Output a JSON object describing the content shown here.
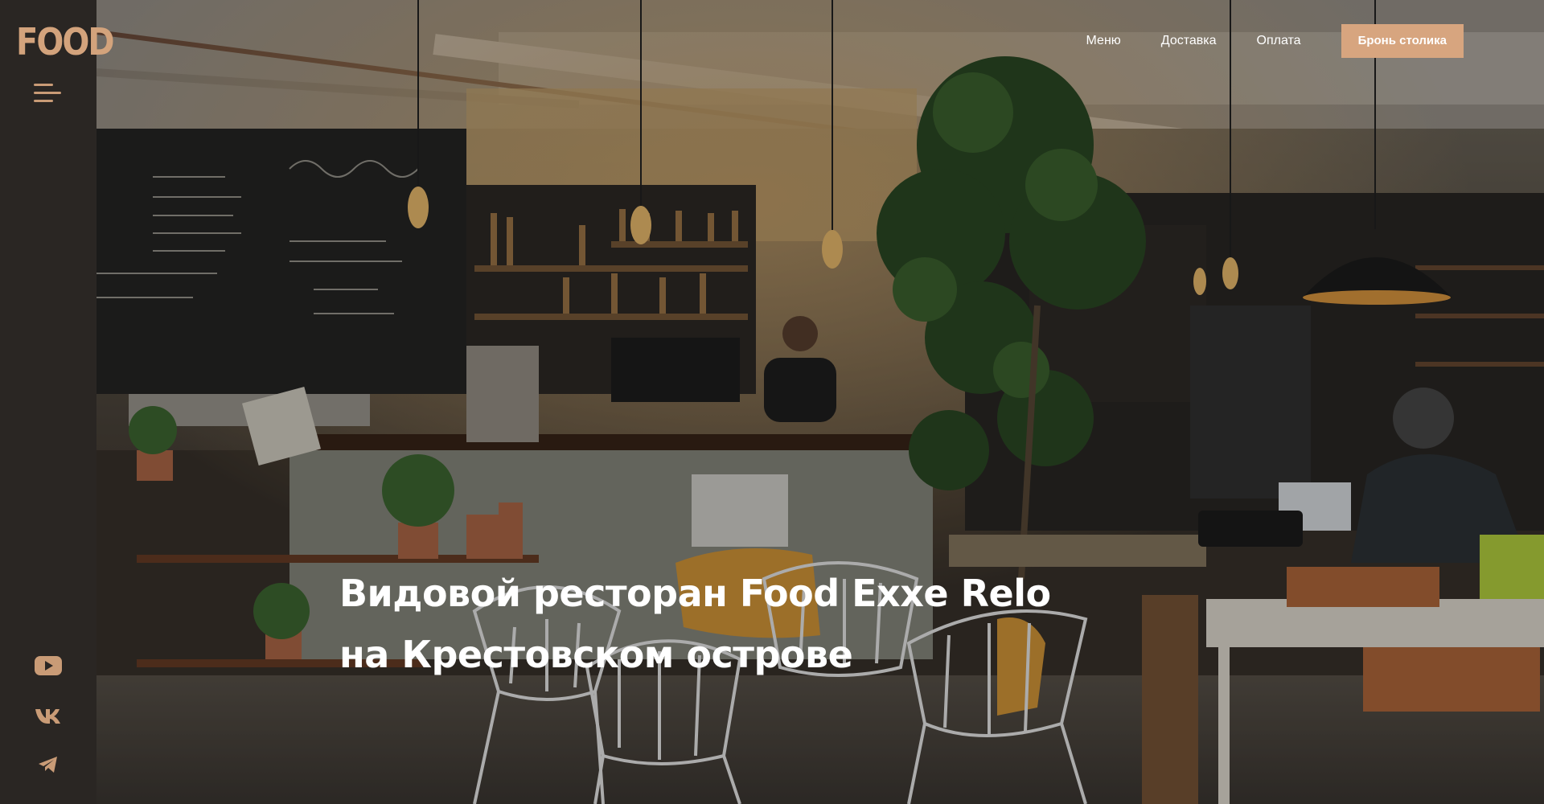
{
  "sidebar": {
    "logo": "FOOD",
    "menu_icon": "hamburger-menu-icon",
    "social": [
      {
        "name": "youtube-icon"
      },
      {
        "name": "vk-icon"
      },
      {
        "name": "telegram-icon"
      }
    ]
  },
  "nav": {
    "links": [
      "Меню",
      "Доставка",
      "Оплата"
    ],
    "cta": "Бронь столика"
  },
  "hero": {
    "line1": "Видовой ресторан Food Exxe Relo",
    "line2": "на Крестовском острове"
  },
  "colors": {
    "accent": "#d7a57f",
    "sidebar": "#2a2623",
    "text": "#ffffff"
  }
}
